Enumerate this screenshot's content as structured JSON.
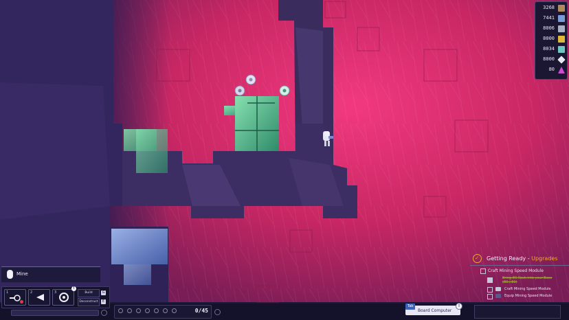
{
  "resources": [
    {
      "value": "3268",
      "icon": "ore-brown-icon",
      "color": "#b0895c"
    },
    {
      "value": "7441",
      "icon": "ore-blue-icon",
      "color": "#7a9bd6"
    },
    {
      "value": "8006",
      "icon": "ore-gray-icon",
      "color": "#a8b1c4"
    },
    {
      "value": "8000",
      "icon": "ore-yellow-icon",
      "color": "#e0b93a"
    },
    {
      "value": "8034",
      "icon": "ore-teal-icon",
      "color": "#6fc7c2"
    },
    {
      "value": "8000",
      "icon": "ore-crystal-icon",
      "color": "#e8e8f2"
    },
    {
      "value": "80",
      "icon": "ore-magenta-icon",
      "color": "#cc4cd2"
    }
  ],
  "hotbar": {
    "action_label": "Mine",
    "slots": [
      {
        "num": "1",
        "icon": "mining-laser-icon"
      },
      {
        "num": "2",
        "icon": "flag-icon"
      },
      {
        "num": "3",
        "icon": "drill-disc-icon",
        "badge": "!"
      }
    ],
    "build_label": "Build",
    "build_key": "G",
    "deconstruct_label": "Deconstruct",
    "deconstruct_key": "E"
  },
  "inventory": {
    "count": "0/45"
  },
  "board_computer": {
    "key": "Tab",
    "label": "Board Computer",
    "badge": "!"
  },
  "quest": {
    "title_main": "Getting Ready - ",
    "title_accent": "Upgrades",
    "accent_color": "#f0a938",
    "items": [
      {
        "text": "Craft Mining Speed Module",
        "done": false,
        "level": 0
      },
      {
        "text": "Bring 80 Rock into your Base",
        "progress": "(80 / 80)",
        "done": true,
        "level": 1
      },
      {
        "text": "Craft Mining Speed Module",
        "done": false,
        "level": 1
      },
      {
        "text": "Equip Mining Speed Module",
        "done": false,
        "level": 1
      }
    ]
  },
  "colors": {
    "rock_pink": "#d02f6e",
    "cave_purple": "#3a2d5e",
    "ore_green": "#6cc79a",
    "ore_blue": "#6f86c6"
  }
}
